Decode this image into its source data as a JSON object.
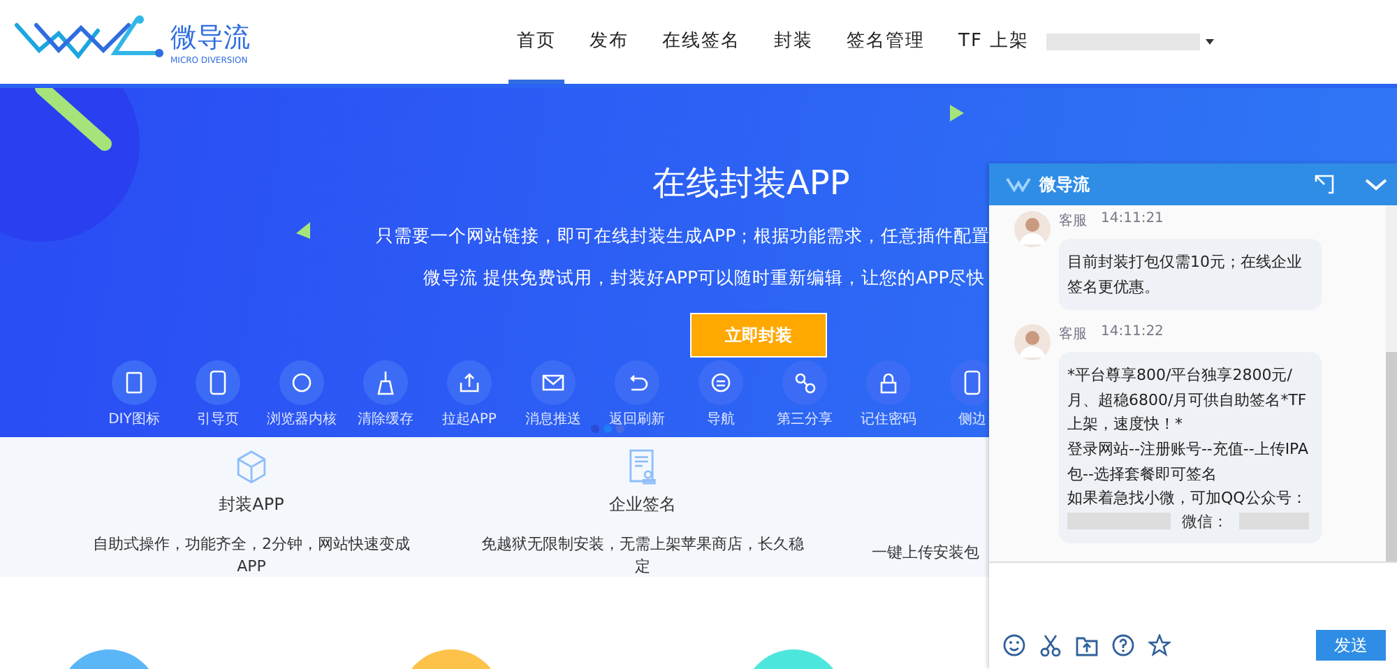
{
  "logo": {
    "name": "微导流",
    "tagline": "MICRO DIVERSION"
  },
  "nav": [
    {
      "label": "首页",
      "selected": true
    },
    {
      "label": "发布",
      "selected": false
    },
    {
      "label": "在线签名",
      "selected": false
    },
    {
      "label": "封装",
      "selected": false
    },
    {
      "label": "签名管理",
      "selected": false
    },
    {
      "label": "TF 上架",
      "selected": false
    }
  ],
  "hero": {
    "title": "在线封装APP",
    "lines": [
      "只需要一个网站链接，即可在线封装生成APP；根据功能需求，任意插件配置",
      "微导流 提供免费试用，封装好APP可以随时重新编辑，让您的APP尽快"
    ],
    "button": "立即封装",
    "features": [
      {
        "label": "DIY图标",
        "kind": "doc"
      },
      {
        "label": "引导页",
        "kind": "phone"
      },
      {
        "label": "浏览器内核",
        "kind": "globe"
      },
      {
        "label": "清除缓存",
        "kind": "broom"
      },
      {
        "label": "拉起APP",
        "kind": "share"
      },
      {
        "label": "消息推送",
        "kind": "mail"
      },
      {
        "label": "返回刷新",
        "kind": "back"
      },
      {
        "label": "导航",
        "kind": "menu"
      },
      {
        "label": "第三分享",
        "kind": "nodes"
      },
      {
        "label": "记住密码",
        "kind": "lock"
      },
      {
        "label": "侧边",
        "kind": "phone2"
      }
    ]
  },
  "services": [
    {
      "title": "封装APP",
      "kind": "cube",
      "text": "自助式操作，功能齐全，2分钟，网站快速变成APP"
    },
    {
      "title": "企业签名",
      "kind": "cert",
      "text": "免越狱无限制安装，无需上架苹果商店，长久稳定"
    },
    {
      "text": "一键上传安装包"
    }
  ],
  "chat": {
    "title": "微导流",
    "messages": [
      {
        "sender": "客服",
        "time": "14:11:21",
        "lines": [
          "目前封装打包仅需10元；在线企业签名更优惠。"
        ]
      },
      {
        "sender": "客服",
        "time": "14:11:22",
        "lines": [
          "*平台尊享800/平台独享2800元/月、超稳6800/月可供自助签名*TF上架，速度快！*",
          "登录网站--注册账号--充值--上传IPA包--选择套餐即可签名",
          "如果着急找小微，可加QQ公众号："
        ],
        "after": "微信："
      }
    ],
    "send": "发送"
  }
}
